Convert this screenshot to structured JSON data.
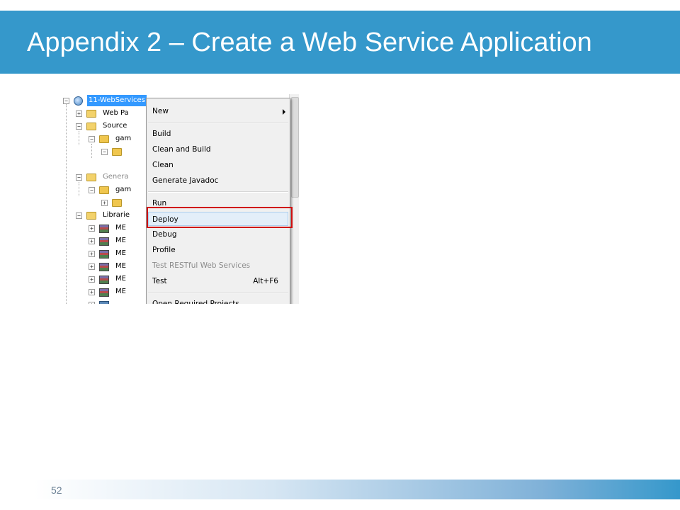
{
  "slide": {
    "title": "Appendix 2 – Create a Web Service Application",
    "page_number": "52",
    "colors": {
      "title_bar": "#3598cb",
      "title_text": "#ffffff",
      "highlight_box": "#d01010"
    }
  },
  "tree": {
    "project": "11-WebServices",
    "items": [
      "Web Pa",
      "Source",
      "gam",
      "Genera",
      "gam",
      "Librarie",
      "ME",
      "ME",
      "ME",
      "ME",
      "ME",
      "ME"
    ]
  },
  "context_menu": {
    "new": "New",
    "build": "Build",
    "clean_and_build": "Clean and Build",
    "clean": "Clean",
    "generate_javadoc": "Generate Javadoc",
    "run": "Run",
    "deploy": "Deploy",
    "debug": "Debug",
    "profile": "Profile",
    "test_restful": "Test RESTful Web Services",
    "test": "Test",
    "test_shortcut": "Alt+F6",
    "open_required": "Open Required Projects"
  }
}
